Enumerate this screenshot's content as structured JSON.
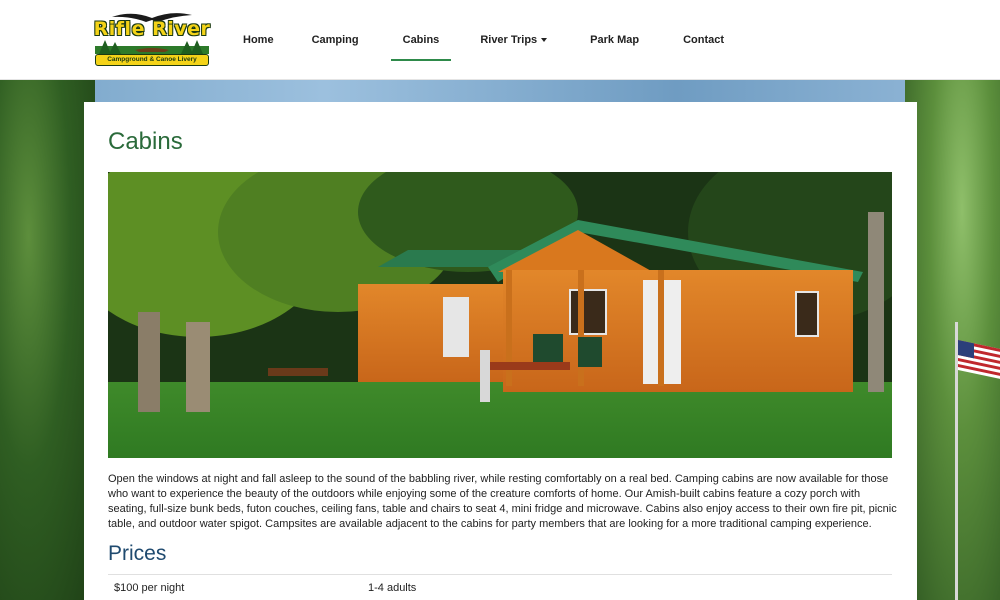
{
  "logo": {
    "title": "Rifle River",
    "subtitle": "Campground & Canoe Livery"
  },
  "nav": {
    "items": [
      {
        "label": "Home"
      },
      {
        "label": "Camping"
      },
      {
        "label": "Cabins"
      },
      {
        "label": "River Trips"
      },
      {
        "label": "Park Map"
      },
      {
        "label": "Contact"
      }
    ]
  },
  "page": {
    "title": "Cabins",
    "description": "Open the windows at night and fall asleep to the sound of the babbling river, while resting comfortably on a real bed. Camping cabins are now available for those who want to experience the beauty of the outdoors while enjoying some of the creature comforts of home.  Our Amish-built cabins feature a cozy porch with seating, full-size bunk beds, futon couches, ceiling fans, table and chairs to seat 4, mini fridge and microwave. Cabins also enjoy access to their own fire pit, picnic table, and outdoor water spigot. Campsites are available adjacent to the cabins for party members that are looking for a more traditional camping experience.",
    "prices_title": "Prices",
    "prices": [
      {
        "price": "$100 per night",
        "guests": "1-4 adults"
      }
    ]
  },
  "colors": {
    "accent": "#2e8a4a",
    "title_green": "#2a6a3a",
    "prices_blue": "#1f4a6f",
    "cabin_orange": "#d9781e",
    "roof_green": "#2f8a5a"
  }
}
